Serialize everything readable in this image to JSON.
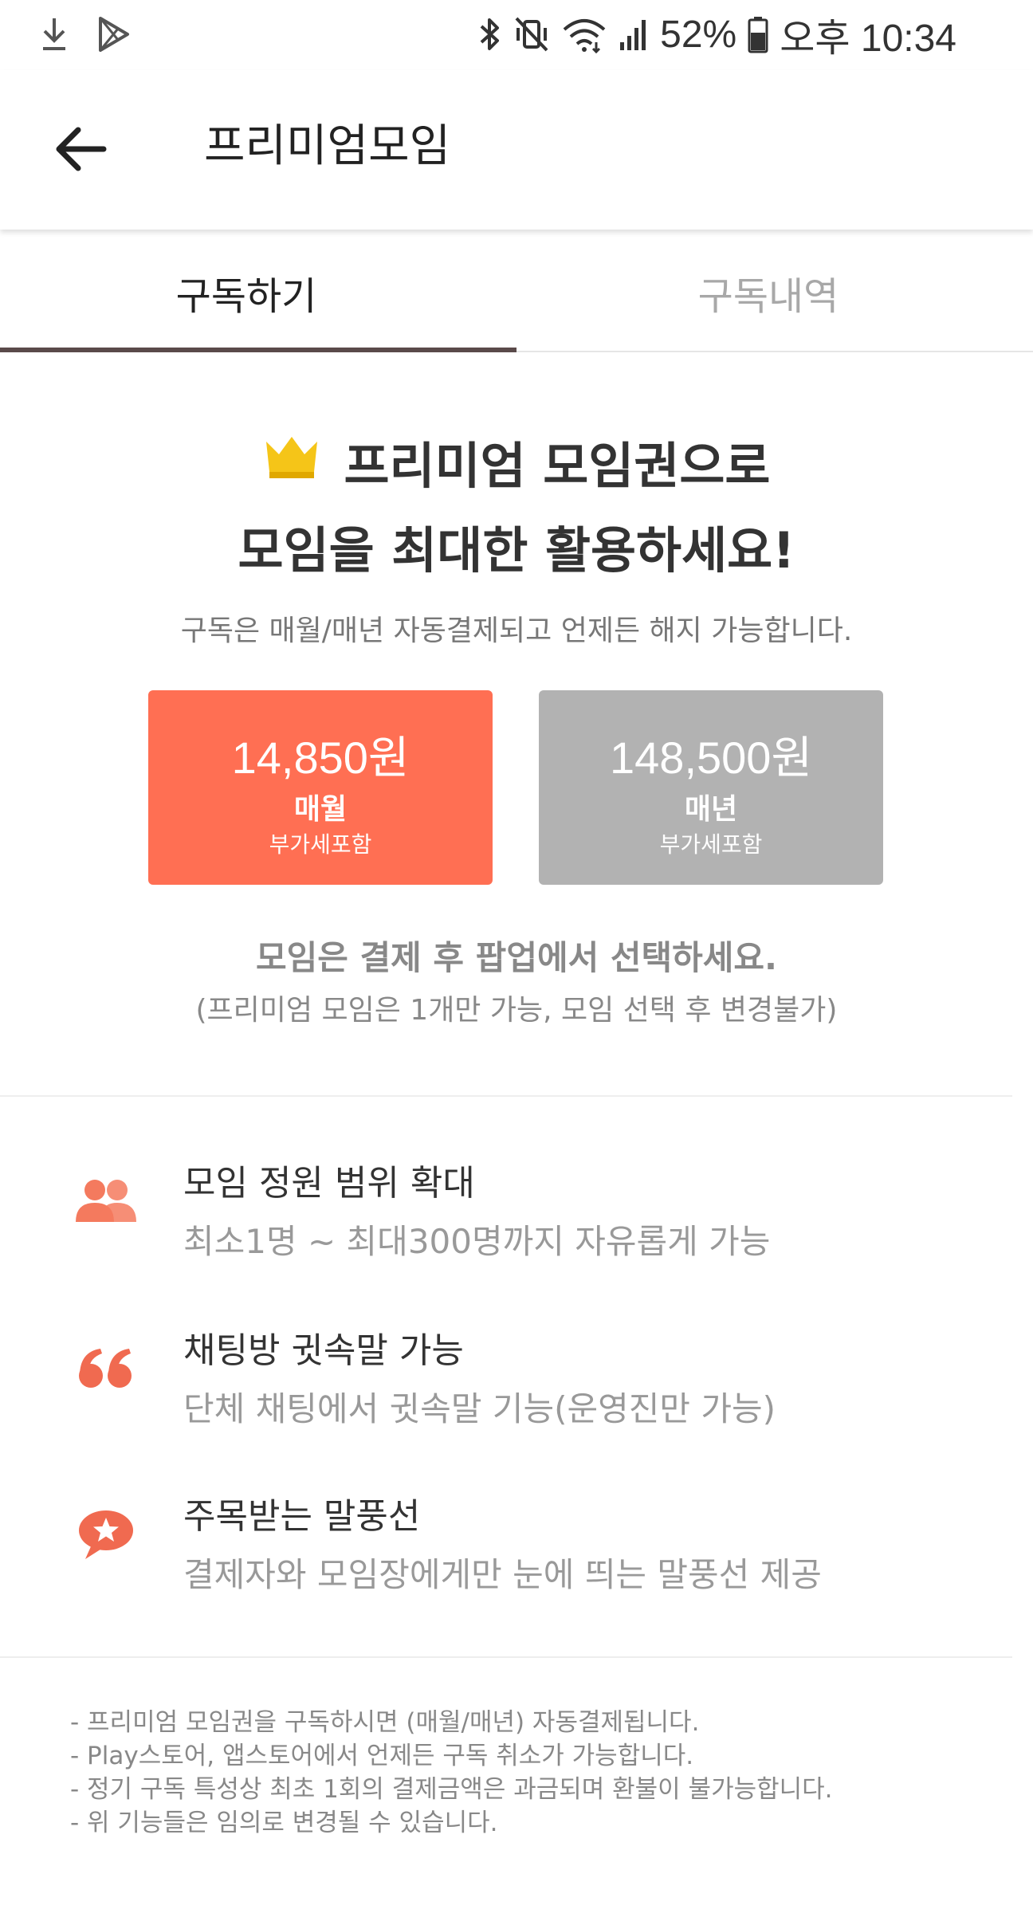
{
  "status_bar": {
    "battery": "52%",
    "time": "오후 10:34",
    "icons": [
      "download-icon",
      "play-store-icon",
      "bluetooth-icon",
      "vibrate-icon",
      "wifi-icon",
      "signal-icon",
      "battery-icon"
    ]
  },
  "app_bar": {
    "title": "프리미엄모임",
    "back_icon": "arrow-left-icon"
  },
  "tabs": [
    {
      "label": "구독하기",
      "active": true
    },
    {
      "label": "구독내역",
      "active": false
    }
  ],
  "hero": {
    "line1": "프리미엄 모임권으로",
    "line2": "모임을 최대한 활용하세요!",
    "subtitle": "구독은 매월/매년 자동결제되고 언제든 해지 가능합니다.",
    "crown_icon": "crown-icon"
  },
  "plans": [
    {
      "price": "14,850원",
      "period": "매월",
      "vat": "부가세포함",
      "color": "#ff6f53",
      "selected": true
    },
    {
      "price": "148,500원",
      "period": "매년",
      "vat": "부가세포함",
      "color": "#b2b2b2",
      "selected": false
    }
  ],
  "notice": {
    "main": "모임은 결제 후 팝업에서 선택하세요.",
    "sub": "(프리미엄 모임은 1개만 가능, 모임 선택 후 변경불가)"
  },
  "features": [
    {
      "icon": "people-icon",
      "title": "모임 정원 범위 확대",
      "desc": "최소1명 ~ 최대300명까지 자유롭게 가능"
    },
    {
      "icon": "quote-icon",
      "title": "채팅방 귓속말 가능",
      "desc": "단체 채팅에서 귓속말 기능(운영진만 가능)"
    },
    {
      "icon": "star-bubble-icon",
      "title": "주목받는 말풍선",
      "desc": "결제자와 모임장에게만 눈에 띄는 말풍선 제공"
    }
  ],
  "footer_notes": [
    "- 프리미엄 모임권을 구독하시면 (매월/매년) 자동결제됩니다.",
    "- Play스토어, 앱스토어에서 언제든 구독 취소가 가능합니다.",
    "- 정기 구독 특성상 최초 1회의 결제금액은 과금되며 환불이 불가능합니다.",
    "- 위 기능들은 임의로 변경될 수 있습니다."
  ],
  "colors": {
    "accent": "#ff6f53",
    "inactive_plan": "#b2b2b2",
    "tab_indicator": "#5a4a4a",
    "crown": "#f5c518"
  }
}
